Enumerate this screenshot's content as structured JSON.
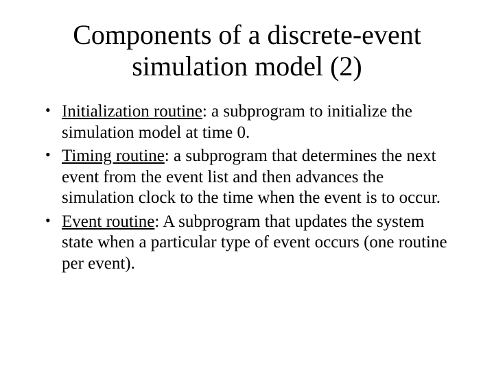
{
  "title": "Components of a discrete-event simulation model (2)",
  "items": [
    {
      "term": "Initialization routine",
      "desc": ": a subprogram to initialize the simulation model at time 0."
    },
    {
      "term": "Timing routine",
      "desc": ": a subprogram that determines the next event from the event list and then advances the simulation clock to the time when the event is to occur."
    },
    {
      "term": "Event routine",
      "desc": ": A subprogram that updates the system state when a particular type of event occurs (one routine per event)."
    }
  ]
}
